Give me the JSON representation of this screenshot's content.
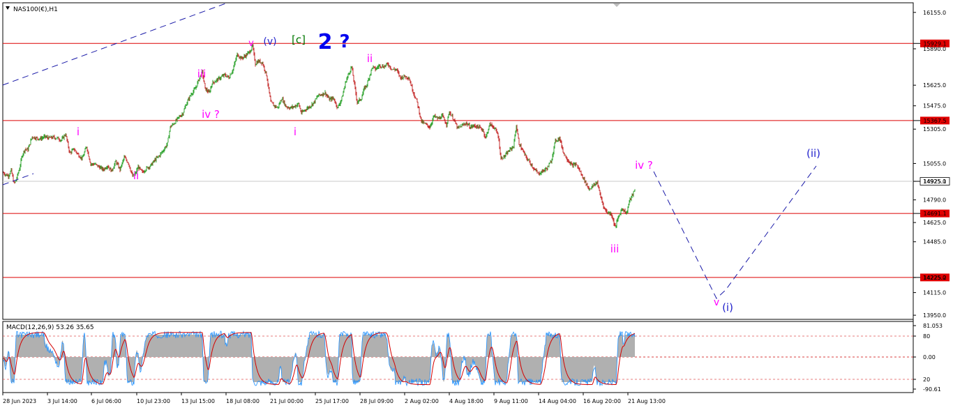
{
  "chart_data": {
    "type": "candlestick",
    "title": "NAS100(€),H1",
    "price_axis": {
      "ylim": [
        13920,
        16225
      ],
      "ticks": [
        16155,
        15890,
        15625,
        15475,
        15305,
        15055,
        14925,
        14790,
        14625,
        14485,
        14225,
        14115,
        13950
      ],
      "tick_labels": [
        "16155.0",
        "15890.0",
        "15625.0",
        "15475.0",
        "15305.0",
        "15055.0",
        "14925.0",
        "14790.0",
        "14625.0",
        "14485.0",
        "14225.0",
        "14115.0",
        "13950.0"
      ]
    },
    "time_axis": {
      "labels": [
        "28 Jun 2023",
        "3 Jul 14:00",
        "6 Jul 06:00",
        "10 Jul 23:00",
        "13 Jul 15:00",
        "18 Jul 08:00",
        "21 Jul 00:00",
        "25 Jul 17:00",
        "28 Jul 09:00",
        "2 Aug 02:00",
        "4 Aug 18:00",
        "9 Aug 11:00",
        "14 Aug 04:00",
        "16 Aug 20:00",
        "21 Aug 13:00"
      ]
    },
    "price_path": [
      [
        0,
        14990
      ],
      [
        4,
        14975
      ],
      [
        8,
        14965
      ],
      [
        12,
        15005
      ],
      [
        16,
        14910
      ],
      [
        18,
        14920
      ],
      [
        20,
        14950
      ],
      [
        24,
        15020
      ],
      [
        28,
        15120
      ],
      [
        32,
        15160
      ],
      [
        36,
        15155
      ],
      [
        42,
        15250
      ],
      [
        48,
        15240
      ],
      [
        54,
        15235
      ],
      [
        60,
        15250
      ],
      [
        66,
        15240
      ],
      [
        72,
        15245
      ],
      [
        78,
        15240
      ],
      [
        84,
        15225
      ],
      [
        90,
        15270
      ],
      [
        96,
        15130
      ],
      [
        102,
        15160
      ],
      [
        108,
        15120
      ],
      [
        114,
        15090
      ],
      [
        120,
        15180
      ],
      [
        126,
        15050
      ],
      [
        132,
        15050
      ],
      [
        138,
        15030
      ],
      [
        144,
        15010
      ],
      [
        150,
        15040
      ],
      [
        156,
        15000
      ],
      [
        162,
        15070
      ],
      [
        168,
        15010
      ],
      [
        174,
        15100
      ],
      [
        180,
        15060
      ],
      [
        186,
        14960
      ],
      [
        190,
        14980
      ],
      [
        194,
        15030
      ],
      [
        200,
        14990
      ],
      [
        206,
        15020
      ],
      [
        212,
        15040
      ],
      [
        218,
        15080
      ],
      [
        224,
        15110
      ],
      [
        230,
        15150
      ],
      [
        236,
        15200
      ],
      [
        240,
        15320
      ],
      [
        246,
        15350
      ],
      [
        252,
        15390
      ],
      [
        258,
        15420
      ],
      [
        264,
        15500
      ],
      [
        270,
        15560
      ],
      [
        276,
        15600
      ],
      [
        282,
        15680
      ],
      [
        286,
        15720
      ],
      [
        290,
        15600
      ],
      [
        296,
        15570
      ],
      [
        300,
        15640
      ],
      [
        306,
        15660
      ],
      [
        312,
        15680
      ],
      [
        318,
        15700
      ],
      [
        324,
        15680
      ],
      [
        330,
        15740
      ],
      [
        336,
        15850
      ],
      [
        342,
        15820
      ],
      [
        348,
        15840
      ],
      [
        354,
        15870
      ],
      [
        358,
        15910
      ],
      [
        362,
        15780
      ],
      [
        366,
        15800
      ],
      [
        372,
        15790
      ],
      [
        378,
        15700
      ],
      [
        384,
        15500
      ],
      [
        388,
        15480
      ],
      [
        394,
        15460
      ],
      [
        400,
        15530
      ],
      [
        406,
        15470
      ],
      [
        412,
        15460
      ],
      [
        418,
        15470
      ],
      [
        424,
        15490
      ],
      [
        428,
        15420
      ],
      [
        434,
        15450
      ],
      [
        440,
        15470
      ],
      [
        446,
        15500
      ],
      [
        452,
        15550
      ],
      [
        458,
        15560
      ],
      [
        462,
        15570
      ],
      [
        468,
        15520
      ],
      [
        474,
        15530
      ],
      [
        480,
        15460
      ],
      [
        486,
        15530
      ],
      [
        492,
        15660
      ],
      [
        500,
        15760
      ],
      [
        504,
        15630
      ],
      [
        508,
        15500
      ],
      [
        514,
        15530
      ],
      [
        518,
        15600
      ],
      [
        522,
        15630
      ],
      [
        526,
        15700
      ],
      [
        530,
        15760
      ],
      [
        534,
        15740
      ],
      [
        540,
        15770
      ],
      [
        546,
        15760
      ],
      [
        552,
        15780
      ],
      [
        558,
        15740
      ],
      [
        564,
        15740
      ],
      [
        570,
        15680
      ],
      [
        576,
        15690
      ],
      [
        582,
        15680
      ],
      [
        588,
        15580
      ],
      [
        594,
        15500
      ],
      [
        600,
        15360
      ],
      [
        606,
        15340
      ],
      [
        612,
        15320
      ],
      [
        618,
        15400
      ],
      [
        624,
        15380
      ],
      [
        630,
        15400
      ],
      [
        636,
        15340
      ],
      [
        640,
        15430
      ],
      [
        646,
        15380
      ],
      [
        652,
        15310
      ],
      [
        658,
        15330
      ],
      [
        664,
        15350
      ],
      [
        670,
        15320
      ],
      [
        676,
        15330
      ],
      [
        682,
        15320
      ],
      [
        688,
        15300
      ],
      [
        692,
        15240
      ],
      [
        698,
        15340
      ],
      [
        704,
        15320
      ],
      [
        710,
        15260
      ],
      [
        714,
        15090
      ],
      [
        720,
        15110
      ],
      [
        726,
        15150
      ],
      [
        732,
        15180
      ],
      [
        736,
        15330
      ],
      [
        740,
        15200
      ],
      [
        744,
        15160
      ],
      [
        750,
        15100
      ],
      [
        756,
        15060
      ],
      [
        762,
        15010
      ],
      [
        768,
        14980
      ],
      [
        774,
        15000
      ],
      [
        780,
        15020
      ],
      [
        786,
        15070
      ],
      [
        792,
        15220
      ],
      [
        798,
        15240
      ],
      [
        804,
        15130
      ],
      [
        810,
        15080
      ],
      [
        816,
        15040
      ],
      [
        822,
        15050
      ],
      [
        828,
        14990
      ],
      [
        834,
        14930
      ],
      [
        840,
        14870
      ],
      [
        846,
        14890
      ],
      [
        852,
        14920
      ],
      [
        856,
        14830
      ],
      [
        862,
        14730
      ],
      [
        866,
        14700
      ],
      [
        872,
        14690
      ],
      [
        878,
        14590
      ],
      [
        882,
        14660
      ],
      [
        888,
        14730
      ],
      [
        894,
        14690
      ],
      [
        898,
        14780
      ],
      [
        902,
        14820
      ],
      [
        906,
        14860
      ],
      [
        909,
        14925
      ]
    ],
    "levels": [
      {
        "label": "15929.1",
        "value": 15929.1
      },
      {
        "label": "15367.5",
        "value": 15367.5
      },
      {
        "label": "14925.1",
        "value": 14925.1
      },
      {
        "label": "14691.1",
        "value": 14691.1
      },
      {
        "label": "14225.2",
        "value": 14225.2
      }
    ],
    "wave_labels": [
      {
        "text": "v",
        "color": "#ff00ff",
        "size": 13
      },
      {
        "text": "(v)",
        "color": "#2222cc",
        "size": 14
      },
      {
        "text": "[c]",
        "color": "#007700",
        "size": 15
      },
      {
        "text": "2",
        "color": "#0000ee",
        "size": 30
      },
      {
        "text": "?",
        "color": "#0000ee",
        "size": 26
      },
      {
        "text": "i",
        "color": "#ff00ff",
        "size": 15
      },
      {
        "text": "ii",
        "color": "#ff00ff",
        "size": 15
      },
      {
        "text": "iii",
        "color": "#ff00ff",
        "size": 15
      },
      {
        "text": "iv ?",
        "color": "#ff00ff",
        "size": 15
      },
      {
        "text": "i",
        "color": "#ff00ff",
        "size": 15
      },
      {
        "text": "ii",
        "color": "#ff00ff",
        "size": 15
      },
      {
        "text": "iii",
        "color": "#ff00ff",
        "size": 15
      },
      {
        "text": "iv ?",
        "color": "#ff00ff",
        "size": 15
      },
      {
        "text": "v",
        "color": "#ff00ff",
        "size": 14
      },
      {
        "text": "(i)",
        "color": "#2222cc",
        "size": 15
      },
      {
        "text": "(ii)",
        "color": "#2222cc",
        "size": 15
      }
    ],
    "macd": {
      "title": "MACD(12,26,9) 53.26 35.65",
      "ticks": [
        81.053,
        80,
        0,
        20,
        -90.61
      ],
      "tick_labels": [
        "81.053",
        "80",
        "0.00",
        "20",
        "-90.61"
      ]
    },
    "colors": {
      "background": "#ffffff",
      "bull_candle": "#1a9a1a",
      "bear_candle": "#c01818",
      "level_line": "#dd0000",
      "level_label_bg": "#e00000",
      "current_price_bg": "#ffffff",
      "projection_line": "#1a1aa8",
      "macd_hist": "#b0b0b0",
      "macd_signal": "#d40000",
      "macd_line": "#1e90ff"
    }
  }
}
